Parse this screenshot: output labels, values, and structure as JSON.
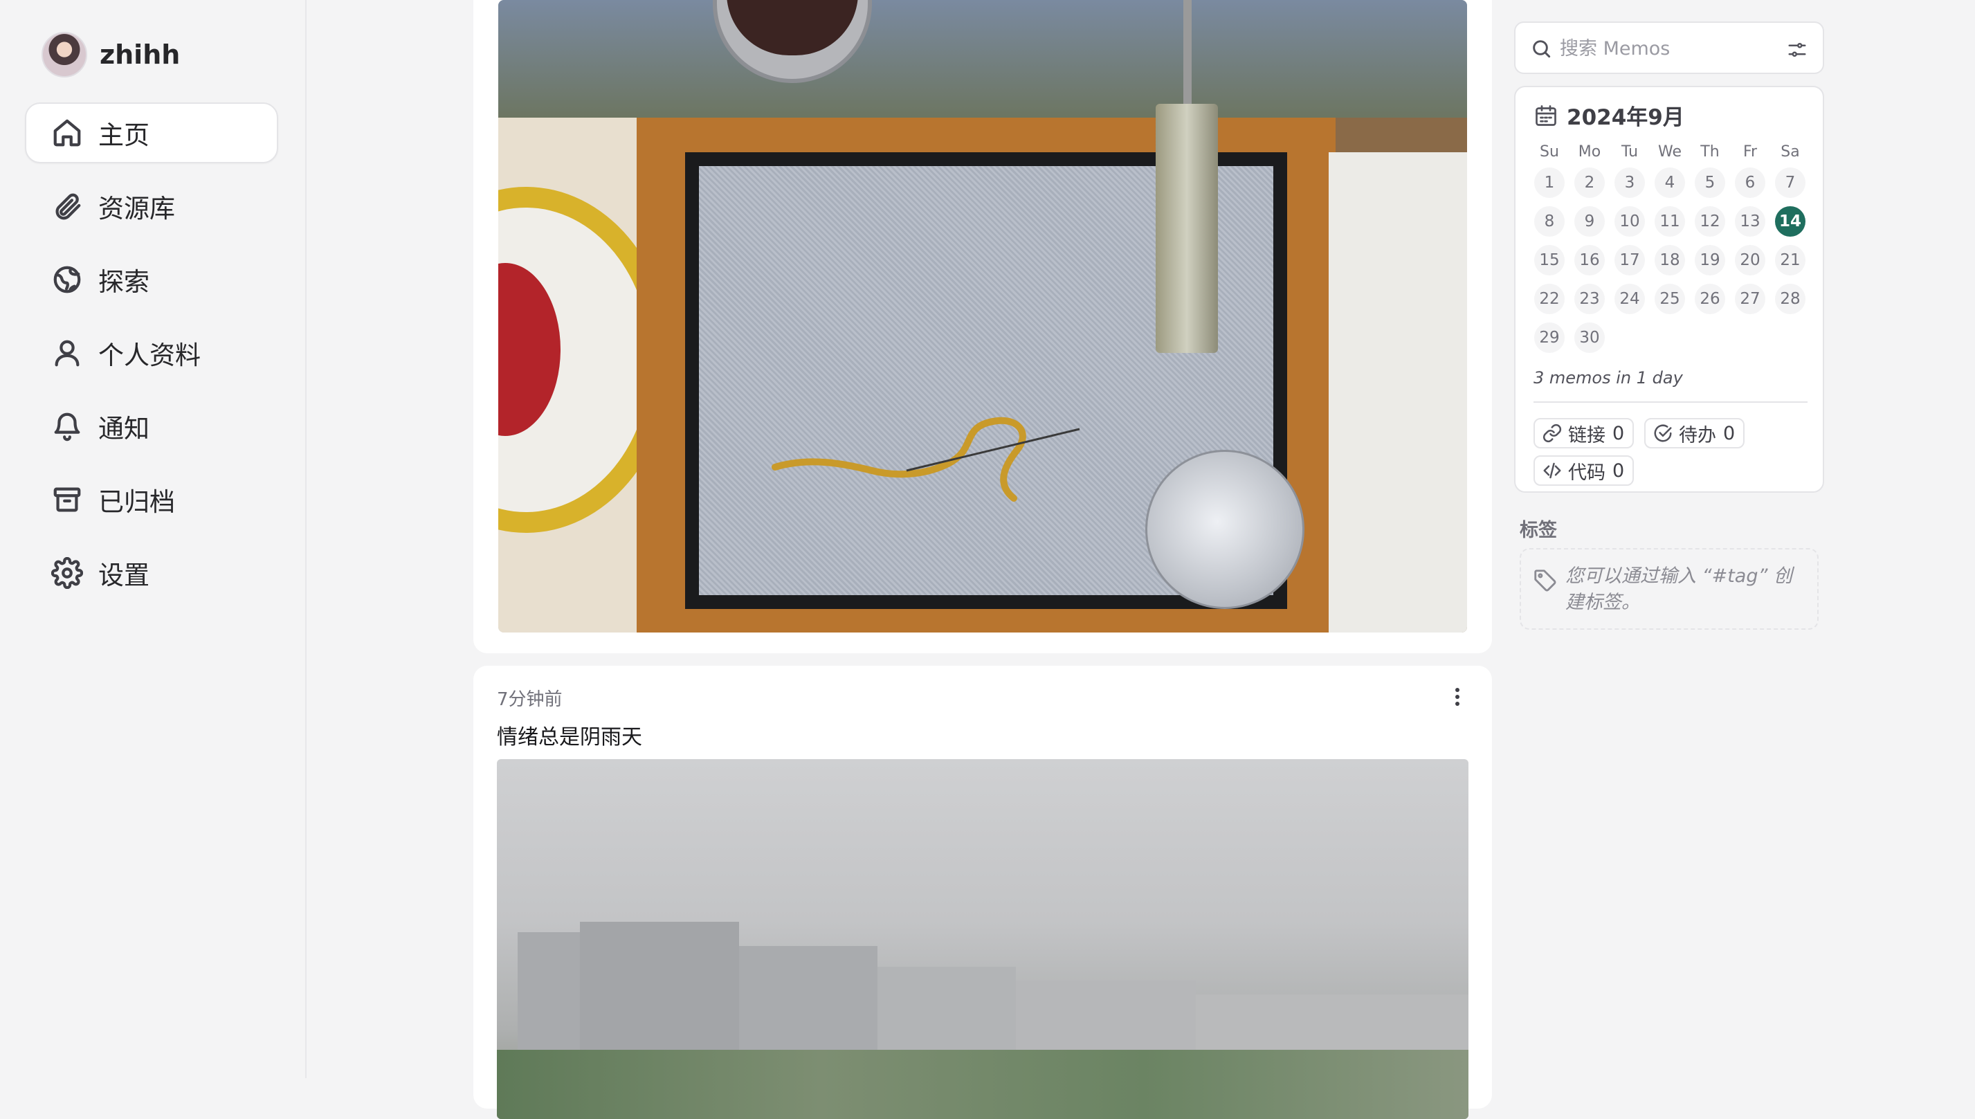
{
  "user": {
    "name": "zhihh"
  },
  "nav": [
    {
      "label": "主页",
      "icon": "home-icon",
      "active": true
    },
    {
      "label": "资源库",
      "icon": "paperclip-icon"
    },
    {
      "label": "探索",
      "icon": "globe-icon"
    },
    {
      "label": "个人资料",
      "icon": "user-icon"
    },
    {
      "label": "通知",
      "icon": "bell-icon"
    },
    {
      "label": "已归档",
      "icon": "archive-icon"
    },
    {
      "label": "设置",
      "icon": "gear-icon"
    }
  ],
  "memos": [
    {
      "photo": "sugar-painting-board-photo"
    },
    {
      "time": "7分钟前",
      "content": "情绪总是阴雨天",
      "photo": "rainy-city-photo"
    }
  ],
  "search": {
    "placeholder": "搜索 Memos"
  },
  "calendar": {
    "month": "2024年9月",
    "weekdays": [
      "Su",
      "Mo",
      "Tu",
      "We",
      "Th",
      "Fr",
      "Sa"
    ],
    "weeks": [
      [
        "1",
        "2",
        "3",
        "4",
        "5",
        "6",
        "7"
      ],
      [
        "8",
        "9",
        "10",
        "11",
        "12",
        "13",
        "14"
      ],
      [
        "15",
        "16",
        "17",
        "18",
        "19",
        "20",
        "21"
      ],
      [
        "22",
        "23",
        "24",
        "25",
        "26",
        "27",
        "28"
      ],
      [
        "29",
        "30",
        "",
        "",
        "",
        "",
        ""
      ]
    ],
    "today": "14",
    "summary": "3 memos in 1 day"
  },
  "stats": {
    "links": {
      "label": "链接",
      "count": "0"
    },
    "todos": {
      "label": "待办",
      "count": "0"
    },
    "code": {
      "label": "代码",
      "count": "0"
    }
  },
  "tags": {
    "title": "标签",
    "hint": "您可以通过输入 “#tag” 创建标签。"
  },
  "colors": {
    "accent": "#1f6e5e",
    "background": "#f4f4f5",
    "card": "#ffffff"
  }
}
